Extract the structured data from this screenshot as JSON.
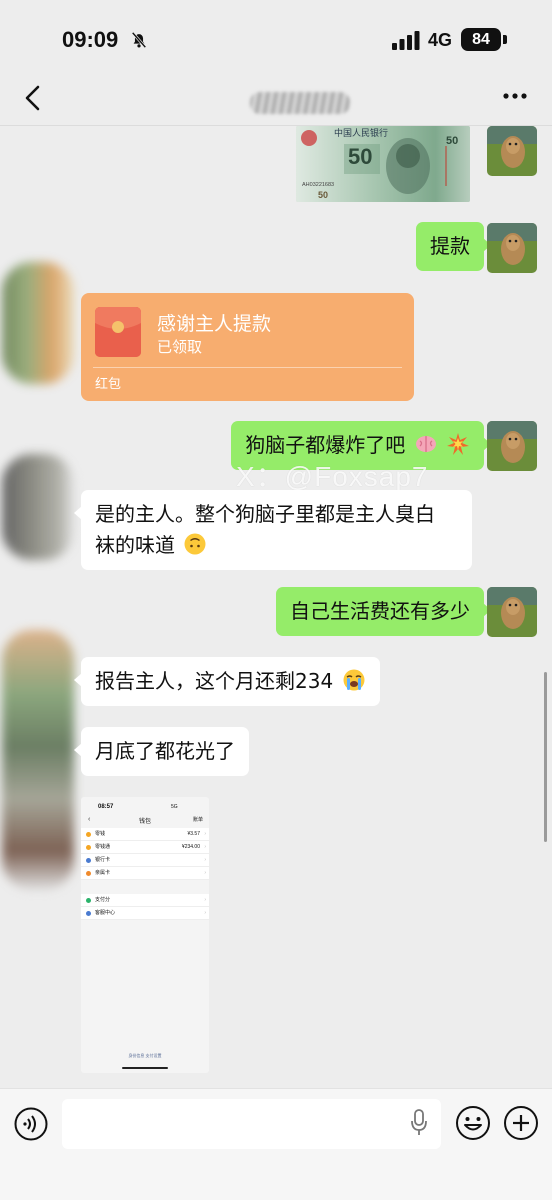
{
  "status_bar": {
    "time": "09:09",
    "network": "4G",
    "battery": "84"
  },
  "messages": [
    {
      "id": "m1",
      "side": "right",
      "type": "image",
      "image_alt": "50 yuan banknote",
      "note_texts": {
        "bank": "中国人民银行",
        "amount": "50",
        "serial": "AH03221683"
      }
    },
    {
      "id": "m2",
      "side": "right",
      "type": "text",
      "text": "提款"
    },
    {
      "id": "m3",
      "side": "left",
      "type": "red_packet",
      "title": "感谢主人提款",
      "status": "已领取",
      "label": "红包"
    },
    {
      "id": "m4",
      "side": "right",
      "type": "text",
      "text": "狗脑子都爆炸了吧",
      "emojis": [
        "brain-emoji",
        "collision-emoji"
      ]
    },
    {
      "id": "m5",
      "side": "left",
      "type": "text",
      "line1": "是的主人。整个狗脑子里都是主人臭白",
      "line2": "袜的味道",
      "emojis": [
        "upside-down-face-emoji"
      ]
    },
    {
      "id": "m6",
      "side": "right",
      "type": "text",
      "text": "自己生活费还有多少"
    },
    {
      "id": "m7",
      "side": "left",
      "type": "text",
      "text": "报告主人，这个月还剩234",
      "emojis": [
        "loudly-crying-face-emoji"
      ]
    },
    {
      "id": "m8",
      "side": "left",
      "type": "text",
      "text": "月底了都花光了"
    },
    {
      "id": "m9",
      "side": "left",
      "type": "image",
      "image_alt": "wallet screenshot"
    }
  ],
  "watermark": "X：@Foxsap7",
  "wallet_screenshot": {
    "time": "08:57",
    "status": "5G",
    "title": "钱包",
    "right_link": "账单",
    "rows_group1": [
      {
        "label": "零钱",
        "value": "¥3.57",
        "color": "#f5a623"
      },
      {
        "label": "零钱通",
        "value": "¥234.00",
        "color": "#f5a623"
      },
      {
        "label": "银行卡",
        "value": "",
        "color": "#4a7bd0"
      },
      {
        "label": "亲属卡",
        "value": "",
        "color": "#f08a2c"
      }
    ],
    "rows_group2": [
      {
        "label": "支付分",
        "value": "",
        "color": "#2bb36b"
      },
      {
        "label": "客服中心",
        "value": "",
        "color": "#4a7bd0"
      }
    ],
    "footer": "身份信息  支付设置"
  },
  "colors": {
    "background": "#ededed",
    "green_bubble": "#95ec69",
    "red_packet": "#f7ad6f"
  }
}
